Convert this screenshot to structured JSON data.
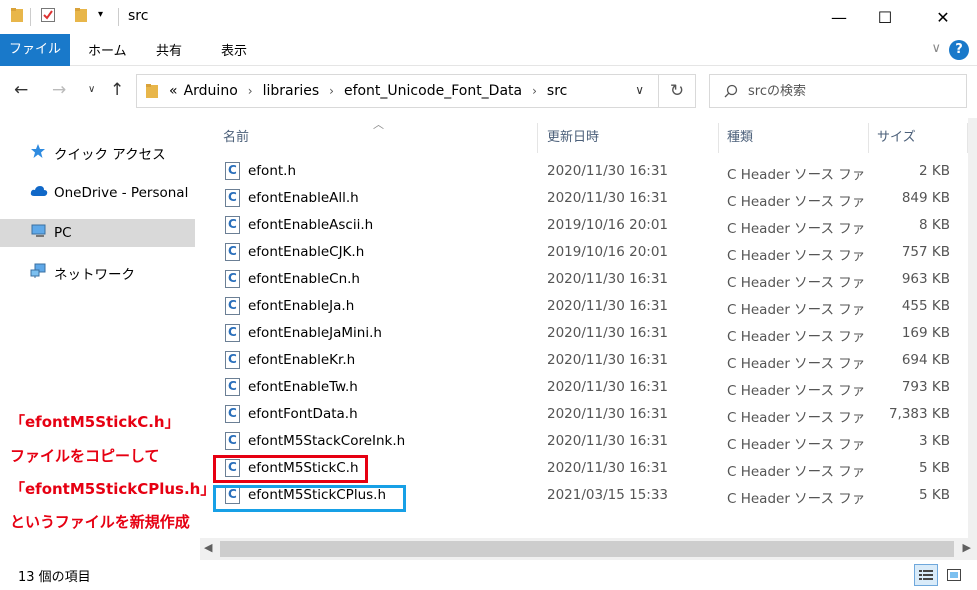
{
  "window": {
    "title": "src",
    "minimize": "—",
    "maximize": "☐",
    "close": "✕"
  },
  "ribbon": {
    "tabs": [
      "ファイル",
      "ホーム",
      "共有",
      "表示"
    ],
    "help": "?",
    "collapse": "∨"
  },
  "address": {
    "overflow": "«",
    "crumbs": [
      "Arduino",
      "libraries",
      "efont_Unicode_Font_Data",
      "src"
    ],
    "search_placeholder": "srcの検索"
  },
  "nav_pane": {
    "items": [
      {
        "label": "クイック アクセス",
        "icon": "star-icon"
      },
      {
        "label": "OneDrive - Personal",
        "icon": "cloud-icon"
      },
      {
        "label": "PC",
        "icon": "computer-icon"
      },
      {
        "label": "ネットワーク",
        "icon": "network-icon"
      }
    ],
    "selected": "PC"
  },
  "columns": [
    "名前",
    "更新日時",
    "種類",
    "サイズ"
  ],
  "files": [
    {
      "name": "efont.h",
      "date": "2020/11/30 16:31",
      "type": "C Header ソース ファ",
      "size": "2 KB"
    },
    {
      "name": "efontEnableAll.h",
      "date": "2020/11/30 16:31",
      "type": "C Header ソース ファ",
      "size": "849 KB"
    },
    {
      "name": "efontEnableAscii.h",
      "date": "2019/10/16 20:01",
      "type": "C Header ソース ファ",
      "size": "8 KB"
    },
    {
      "name": "efontEnableCJK.h",
      "date": "2019/10/16 20:01",
      "type": "C Header ソース ファ",
      "size": "757 KB"
    },
    {
      "name": "efontEnableCn.h",
      "date": "2020/11/30 16:31",
      "type": "C Header ソース ファ",
      "size": "963 KB"
    },
    {
      "name": "efontEnableJa.h",
      "date": "2020/11/30 16:31",
      "type": "C Header ソース ファ",
      "size": "455 KB"
    },
    {
      "name": "efontEnableJaMini.h",
      "date": "2020/11/30 16:31",
      "type": "C Header ソース ファ",
      "size": "169 KB"
    },
    {
      "name": "efontEnableKr.h",
      "date": "2020/11/30 16:31",
      "type": "C Header ソース ファ",
      "size": "694 KB"
    },
    {
      "name": "efontEnableTw.h",
      "date": "2020/11/30 16:31",
      "type": "C Header ソース ファ",
      "size": "793 KB"
    },
    {
      "name": "efontFontData.h",
      "date": "2020/11/30 16:31",
      "type": "C Header ソース ファ",
      "size": "7,383 KB"
    },
    {
      "name": "efontM5StackCoreInk.h",
      "date": "2020/11/30 16:31",
      "type": "C Header ソース ファ",
      "size": "3 KB"
    },
    {
      "name": "efontM5StickC.h",
      "date": "2020/11/30 16:31",
      "type": "C Header ソース ファ",
      "size": "5 KB"
    },
    {
      "name": "efontM5StickCPlus.h",
      "date": "2021/03/15 15:33",
      "type": "C Header ソース ファ",
      "size": "5 KB"
    }
  ],
  "annotation": {
    "lines": [
      "「efontM5StickC.h」",
      "ファイルをコピーして",
      "「efontM5StickCPlus.h」",
      "というファイルを新規作成"
    ],
    "color": "#e60012"
  },
  "highlight_colors": {
    "red": "#e60012",
    "blue": "#17a0e6"
  },
  "status": {
    "item_count": "13 個の項目"
  }
}
